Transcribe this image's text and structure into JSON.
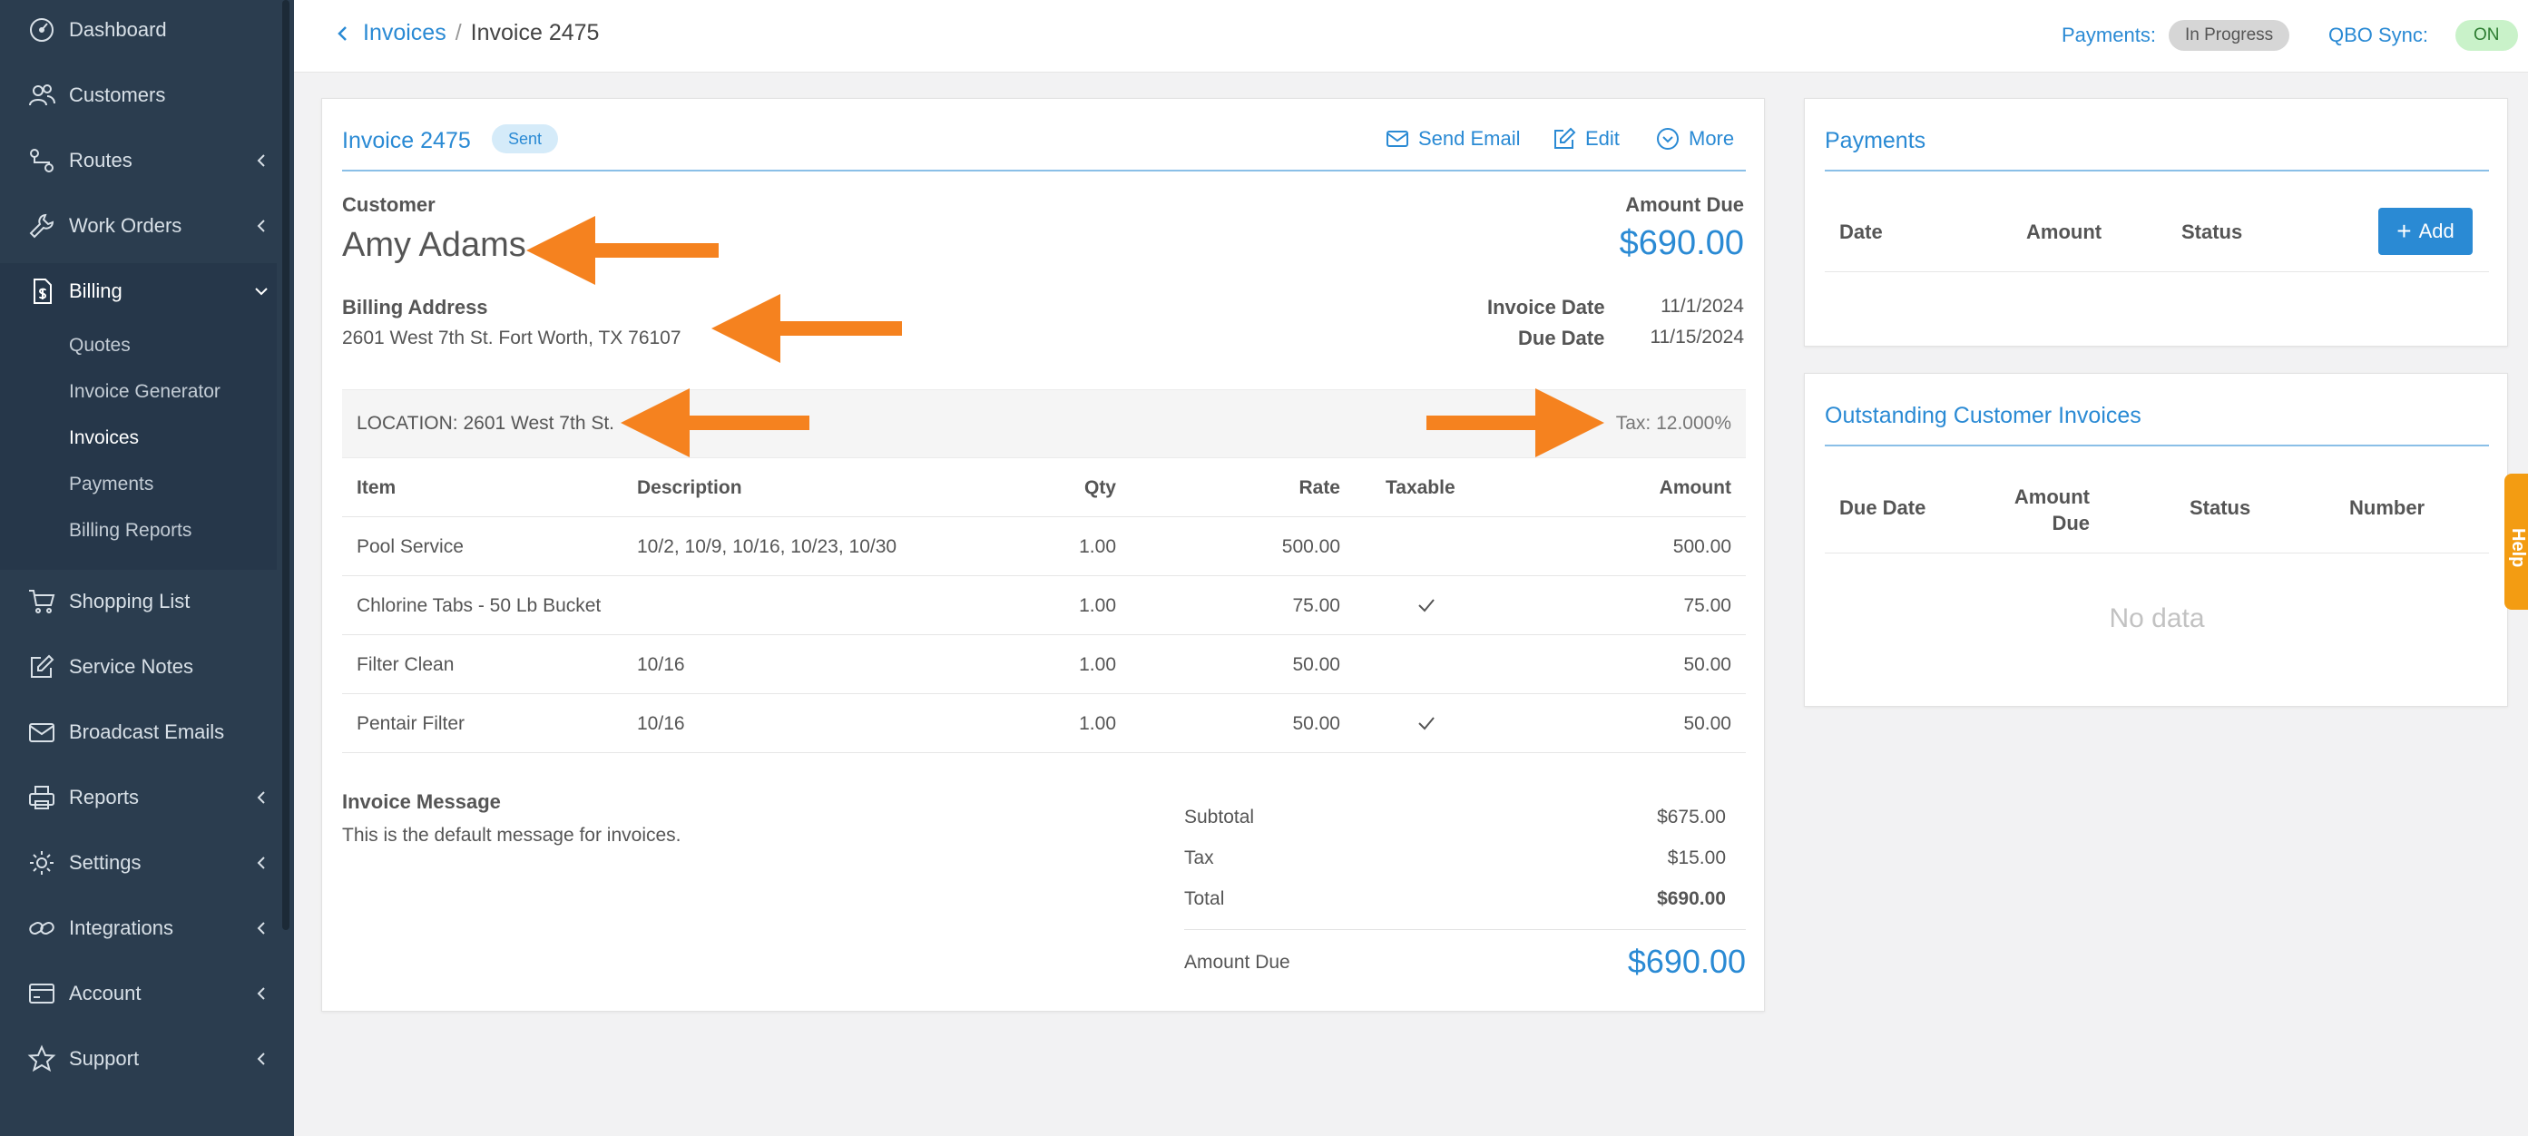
{
  "sidebar": {
    "items": [
      {
        "label": "Dashboard",
        "icon": "dashboard-icon"
      },
      {
        "label": "Customers",
        "icon": "customers-icon"
      },
      {
        "label": "Routes",
        "icon": "routes-icon"
      },
      {
        "label": "Work Orders",
        "icon": "wrench-icon"
      },
      {
        "label": "Billing",
        "icon": "billing-icon"
      },
      {
        "label": "Shopping List",
        "icon": "cart-icon"
      },
      {
        "label": "Service Notes",
        "icon": "edit-icon"
      },
      {
        "label": "Broadcast Emails",
        "icon": "mail-icon"
      },
      {
        "label": "Reports",
        "icon": "printer-icon"
      },
      {
        "label": "Settings",
        "icon": "gear-icon"
      },
      {
        "label": "Integrations",
        "icon": "link-icon"
      },
      {
        "label": "Account",
        "icon": "card-icon"
      },
      {
        "label": "Support",
        "icon": "star-icon"
      }
    ],
    "billing_sub": [
      "Quotes",
      "Invoice Generator",
      "Invoices",
      "Payments",
      "Billing Reports"
    ],
    "active_sub": "Invoices"
  },
  "topbar": {
    "crumb_link": "Invoices",
    "crumb_sep": "/",
    "crumb_current": "Invoice 2475",
    "payments_label": "Payments:",
    "payments_status": "In Progress",
    "qbo_label": "QBO Sync:",
    "qbo_status": "ON"
  },
  "invoice": {
    "title": "Invoice 2475",
    "status": "Sent",
    "actions": {
      "send_email": "Send Email",
      "edit": "Edit",
      "more": "More"
    },
    "customer_label": "Customer",
    "customer_name": "Amy Adams",
    "amount_due_label": "Amount Due",
    "amount_due": "$690.00",
    "billing_address_label": "Billing Address",
    "billing_address": "2601 West 7th St. Fort Worth, TX 76107",
    "invoice_date_label": "Invoice Date",
    "invoice_date": "11/1/2024",
    "due_date_label": "Due Date",
    "due_date": "11/15/2024",
    "location": "LOCATION: 2601 West 7th St.",
    "tax_rate": "Tax: 12.000%",
    "columns": [
      "Item",
      "Description",
      "Qty",
      "Rate",
      "Taxable",
      "Amount"
    ],
    "rows": [
      {
        "item": "Pool Service",
        "description": "10/2, 10/9, 10/16, 10/23, 10/30",
        "qty": "1.00",
        "rate": "500.00",
        "taxable": false,
        "amount": "500.00"
      },
      {
        "item": "Chlorine Tabs - 50 Lb Bucket",
        "description": "",
        "qty": "1.00",
        "rate": "75.00",
        "taxable": true,
        "amount": "75.00"
      },
      {
        "item": "Filter Clean",
        "description": "10/16",
        "qty": "1.00",
        "rate": "50.00",
        "taxable": false,
        "amount": "50.00"
      },
      {
        "item": "Pentair Filter",
        "description": "10/16",
        "qty": "1.00",
        "rate": "50.00",
        "taxable": true,
        "amount": "50.00"
      }
    ],
    "message_label": "Invoice Message",
    "message": "This is the default message for invoices.",
    "subtotal_label": "Subtotal",
    "subtotal": "$675.00",
    "tax_label": "Tax",
    "tax": "$15.00",
    "total_label": "Total",
    "total": "$690.00",
    "footer_due_label": "Amount Due",
    "footer_due": "$690.00"
  },
  "payments": {
    "title": "Payments",
    "columns": [
      "Date",
      "Amount",
      "Status"
    ],
    "add_label": "Add"
  },
  "outstanding": {
    "title": "Outstanding Customer Invoices",
    "columns": [
      "Due Date",
      "Amount Due",
      "Status",
      "Number"
    ],
    "empty": "No data"
  },
  "help": "Help",
  "colors": {
    "accent": "#2a8ad4",
    "sidebar": "#2b3d4f",
    "annotation": "#f5821f"
  }
}
